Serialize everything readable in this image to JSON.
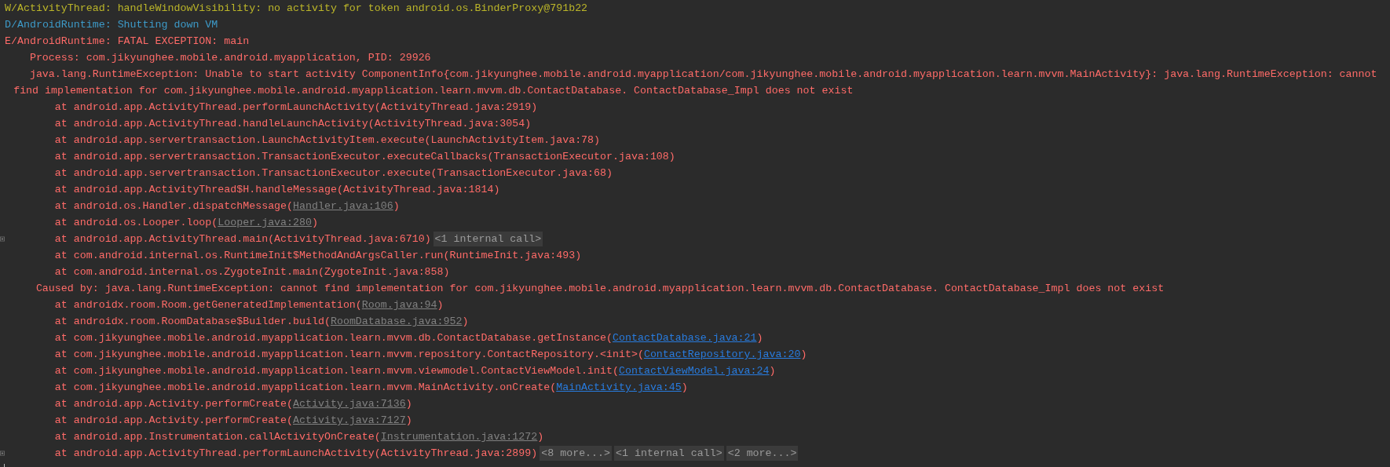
{
  "log_lines": [
    {
      "kind": "header",
      "color": "#bbb529",
      "text": "W/ActivityThread: handleWindowVisibility: no activity for token android.os.BinderProxy@791b22"
    },
    {
      "kind": "header",
      "color": "#3d9ac8",
      "text": "D/AndroidRuntime: Shutting down VM"
    },
    {
      "kind": "header",
      "color": "#ff6b68",
      "text": "E/AndroidRuntime: FATAL EXCEPTION: main"
    },
    {
      "kind": "detail",
      "color": "#ff6b68",
      "text": "Process: com.jikyunghee.mobile.android.myapplication, PID: 29926"
    },
    {
      "kind": "detail",
      "color": "#ff6b68",
      "text": "java.lang.RuntimeException: Unable to start activity ComponentInfo{com.jikyunghee.mobile.android.myapplication/com.jikyunghee.mobile.android.myapplication.learn.mvvm.MainActivity}: java.lang.RuntimeException: cannot"
    },
    {
      "kind": "wrap",
      "color": "#ff6b68",
      "text": "find implementation for com.jikyunghee.mobile.android.myapplication.learn.mvvm.db.ContactDatabase. ContactDatabase_Impl does not exist"
    },
    {
      "kind": "frame",
      "color": "#ff6b68",
      "call": "at android.app.ActivityThread.performLaunchActivity(",
      "source": {
        "kind": "plain",
        "text": "ActivityThread.java:2919"
      },
      "close": ")"
    },
    {
      "kind": "frame",
      "color": "#ff6b68",
      "call": "at android.app.ActivityThread.handleLaunchActivity(",
      "source": {
        "kind": "plain",
        "text": "ActivityThread.java:3054"
      },
      "close": ")"
    },
    {
      "kind": "frame",
      "color": "#ff6b68",
      "call": "at android.app.servertransaction.LaunchActivityItem.execute(",
      "source": {
        "kind": "plain",
        "text": "LaunchActivityItem.java:78"
      },
      "close": ")"
    },
    {
      "kind": "frame",
      "color": "#ff6b68",
      "call": "at android.app.servertransaction.TransactionExecutor.executeCallbacks(",
      "source": {
        "kind": "plain",
        "text": "TransactionExecutor.java:108"
      },
      "close": ")"
    },
    {
      "kind": "frame",
      "color": "#ff6b68",
      "call": "at android.app.servertransaction.TransactionExecutor.execute(",
      "source": {
        "kind": "plain",
        "text": "TransactionExecutor.java:68"
      },
      "close": ")"
    },
    {
      "kind": "frame",
      "color": "#ff6b68",
      "call": "at android.app.ActivityThread$H.handleMessage(",
      "source": {
        "kind": "plain",
        "text": "ActivityThread.java:1814"
      },
      "close": ")"
    },
    {
      "kind": "frame",
      "color": "#ff6b68",
      "call": "at android.os.Handler.dispatchMessage(",
      "source": {
        "kind": "library",
        "text": "Handler.java:106"
      },
      "close": ")"
    },
    {
      "kind": "frame",
      "color": "#ff6b68",
      "call": "at android.os.Looper.loop(",
      "source": {
        "kind": "library",
        "text": "Looper.java:280"
      },
      "close": ")"
    },
    {
      "kind": "frame",
      "color": "#ff6b68",
      "foldable": true,
      "call": "at android.app.ActivityThread.main(",
      "source": {
        "kind": "plain",
        "text": "ActivityThread.java:6710"
      },
      "close": ")",
      "folds": [
        "<1 internal call>"
      ]
    },
    {
      "kind": "frame",
      "color": "#ff6b68",
      "call": "at com.android.internal.os.RuntimeInit$MethodAndArgsCaller.run(",
      "source": {
        "kind": "plain",
        "text": "RuntimeInit.java:493"
      },
      "close": ")"
    },
    {
      "kind": "frame",
      "color": "#ff6b68",
      "call": "at com.android.internal.os.ZygoteInit.main(",
      "source": {
        "kind": "plain",
        "text": "ZygoteInit.java:858"
      },
      "close": ")"
    },
    {
      "kind": "cause",
      "color": "#ff6b68",
      "text": "Caused by: java.lang.RuntimeException: cannot find implementation for com.jikyunghee.mobile.android.myapplication.learn.mvvm.db.ContactDatabase. ContactDatabase_Impl does not exist"
    },
    {
      "kind": "frame",
      "color": "#ff6b68",
      "call": "at androidx.room.Room.getGeneratedImplementation(",
      "source": {
        "kind": "library",
        "text": "Room.java:94"
      },
      "close": ")"
    },
    {
      "kind": "frame",
      "color": "#ff6b68",
      "call": "at androidx.room.RoomDatabase$Builder.build(",
      "source": {
        "kind": "library",
        "text": "RoomDatabase.java:952"
      },
      "close": ")"
    },
    {
      "kind": "frame",
      "color": "#ff6b68",
      "call": "at com.jikyunghee.mobile.android.myapplication.learn.mvvm.db.ContactDatabase.getInstance(",
      "source": {
        "kind": "project",
        "text": "ContactDatabase.java:21"
      },
      "close": ")"
    },
    {
      "kind": "frame",
      "color": "#ff6b68",
      "call": "at com.jikyunghee.mobile.android.myapplication.learn.mvvm.repository.ContactRepository.<init>(",
      "source": {
        "kind": "project",
        "text": "ContactRepository.java:20"
      },
      "close": ")"
    },
    {
      "kind": "frame",
      "color": "#ff6b68",
      "call": "at com.jikyunghee.mobile.android.myapplication.learn.mvvm.viewmodel.ContactViewModel.init(",
      "source": {
        "kind": "project",
        "text": "ContactViewModel.java:24"
      },
      "close": ")"
    },
    {
      "kind": "frame",
      "color": "#ff6b68",
      "call": "at com.jikyunghee.mobile.android.myapplication.learn.mvvm.MainActivity.onCreate(",
      "source": {
        "kind": "project",
        "text": "MainActivity.java:45"
      },
      "close": ")"
    },
    {
      "kind": "frame",
      "color": "#ff6b68",
      "call": "at android.app.Activity.performCreate(",
      "source": {
        "kind": "library",
        "text": "Activity.java:7136"
      },
      "close": ")"
    },
    {
      "kind": "frame",
      "color": "#ff6b68",
      "call": "at android.app.Activity.performCreate(",
      "source": {
        "kind": "library",
        "text": "Activity.java:7127"
      },
      "close": ")"
    },
    {
      "kind": "frame",
      "color": "#ff6b68",
      "call": "at android.app.Instrumentation.callActivityOnCreate(",
      "source": {
        "kind": "library",
        "text": "Instrumentation.java:1272"
      },
      "close": ")"
    },
    {
      "kind": "frame",
      "color": "#ff6b68",
      "foldable": true,
      "call": "at android.app.ActivityThread.performLaunchActivity(",
      "source": {
        "kind": "plain",
        "text": "ActivityThread.java:2899"
      },
      "close": ")",
      "folds": [
        "<8 more...>",
        "<1 internal call>",
        "<2 more...>"
      ]
    }
  ]
}
